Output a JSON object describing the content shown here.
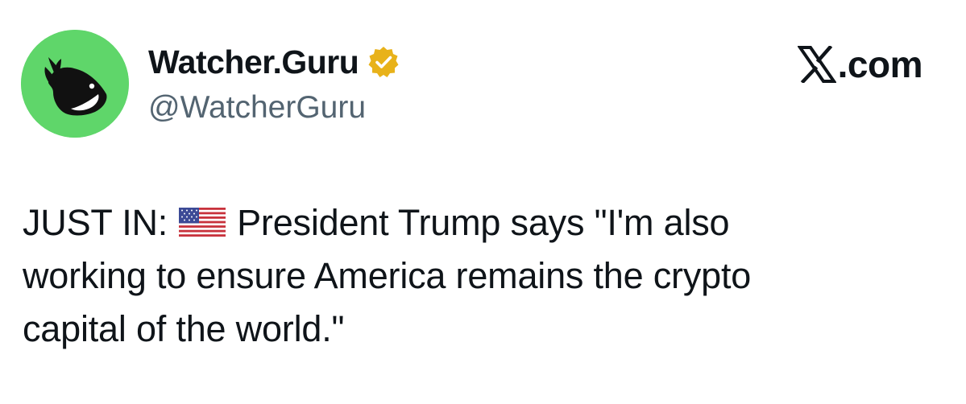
{
  "account": {
    "display_name": "Watcher.Guru",
    "handle": "@WatcherGuru",
    "verified_icon": "verified-badge-icon",
    "avatar_icon": "whale-logo-icon",
    "avatar_bg": "#5fd66a",
    "badge_color": "#e8b21a"
  },
  "brand": {
    "logo_icon": "x-logo-icon",
    "label": ".com"
  },
  "tweet": {
    "prefix": "JUST IN:",
    "flag_icon": "us-flag-icon",
    "line1": "President Trump says \"I'm also",
    "line2": "working to ensure America remains the crypto",
    "line3": "capital of the world.\""
  }
}
